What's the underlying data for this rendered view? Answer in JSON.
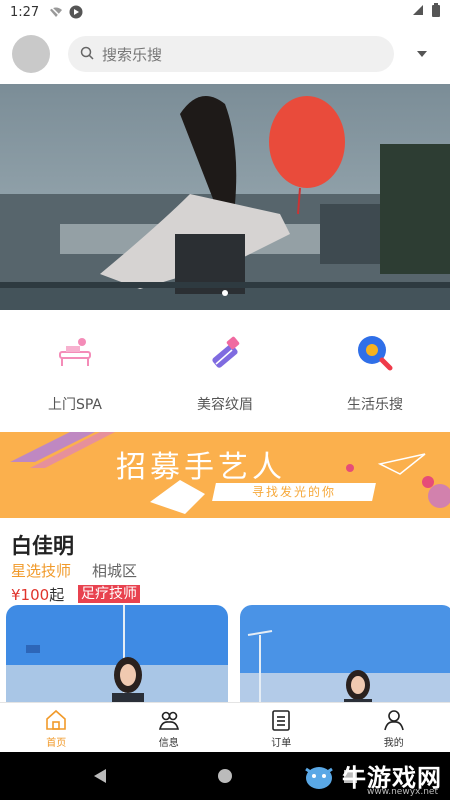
{
  "status_bar": {
    "time": "1:27"
  },
  "search": {
    "placeholder": "搜索乐搜"
  },
  "categories": [
    {
      "label": "上门SPA",
      "icon": "massage-icon"
    },
    {
      "label": "美容纹眉",
      "icon": "lipstick-icon"
    },
    {
      "label": "生活乐搜",
      "icon": "search-magnifier-icon"
    }
  ],
  "recruit_banner": {
    "title": "招募手艺人",
    "subtitle": "寻找发光的你"
  },
  "card": {
    "name": "白佳明",
    "role": "星选技师",
    "district": "相城区",
    "price": "¥100",
    "price_suffix": "起",
    "tag": "足疗技师"
  },
  "tabs": [
    {
      "label": "首页",
      "icon": "home-icon",
      "active": true
    },
    {
      "label": "信息",
      "icon": "contacts-icon",
      "active": false
    },
    {
      "label": "订单",
      "icon": "order-icon",
      "active": false
    },
    {
      "label": "我的",
      "icon": "profile-icon",
      "active": false
    }
  ],
  "watermark": {
    "text": "牛游戏网",
    "url": "www.newyx.net"
  },
  "colors": {
    "accent": "#f19a2a",
    "price": "#e0342c",
    "tag_bg": "#e8424f",
    "recruit_bg": "#fbb04d"
  }
}
